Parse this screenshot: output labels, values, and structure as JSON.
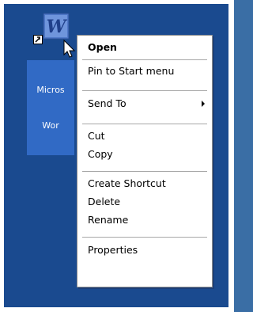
{
  "desktop": {
    "icon": {
      "name": "word-shortcut-icon",
      "label_line1": "Micros",
      "label_line2": "Wor",
      "badge": "W"
    }
  },
  "context_menu": {
    "items": [
      {
        "label": "Open",
        "bold": true
      },
      {
        "label": "Pin to Start menu"
      },
      {
        "label": "Send To",
        "submenu": true
      },
      {
        "label": "Cut"
      },
      {
        "label": "Copy"
      },
      {
        "label": "Create Shortcut"
      },
      {
        "label": "Delete"
      },
      {
        "label": "Rename"
      },
      {
        "label": "Properties"
      }
    ]
  },
  "colors": {
    "desktop_bg": "#1a4a8f",
    "selection": "#316ac5"
  }
}
